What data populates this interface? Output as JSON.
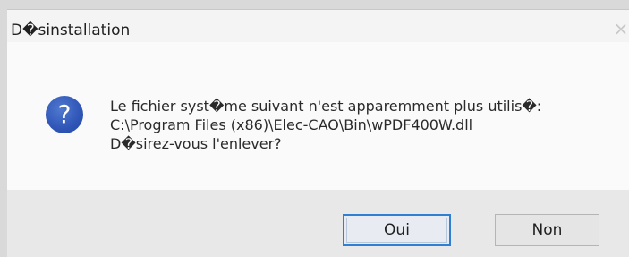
{
  "dialog": {
    "title": "D�sinstallation",
    "close_icon": "close-icon",
    "icon": "question-icon",
    "message_lines": [
      "Le fichier syst�me suivant n'est apparemment plus utilis�:",
      "C:\\Program Files (x86)\\Elec-CAO\\Bin\\wPDF400W.dll",
      "D�sirez-vous l'enlever?"
    ],
    "buttons": {
      "yes_label": "Oui",
      "no_label": "Non"
    }
  },
  "colors": {
    "accent": "#2f7fd3",
    "icon_blue": "#2f55b7"
  }
}
